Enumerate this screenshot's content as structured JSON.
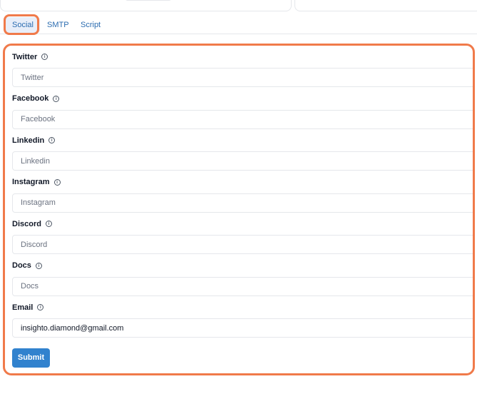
{
  "tabs": [
    {
      "label": "Social",
      "active": true
    },
    {
      "label": "SMTP",
      "active": false
    },
    {
      "label": "Script",
      "active": false
    }
  ],
  "form": {
    "fields": [
      {
        "label": "Twitter",
        "placeholder": "Twitter",
        "value": ""
      },
      {
        "label": "Facebook",
        "placeholder": "Facebook",
        "value": ""
      },
      {
        "label": "Linkedin",
        "placeholder": "Linkedin",
        "value": ""
      },
      {
        "label": "Instagram",
        "placeholder": "Instagram",
        "value": ""
      },
      {
        "label": "Discord",
        "placeholder": "Discord",
        "value": ""
      },
      {
        "label": "Docs",
        "placeholder": "Docs",
        "value": ""
      },
      {
        "label": "Email",
        "placeholder": "Email",
        "value": "insighto.diamond@gmail.com"
      }
    ],
    "info_icon": "info-circle-icon",
    "submit_label": "Submit"
  },
  "colors": {
    "highlight": "#f07a4a",
    "tab_text": "#2b6cb0",
    "tab_active_bg": "#e8eef9",
    "submit_bg": "#3182ce"
  }
}
